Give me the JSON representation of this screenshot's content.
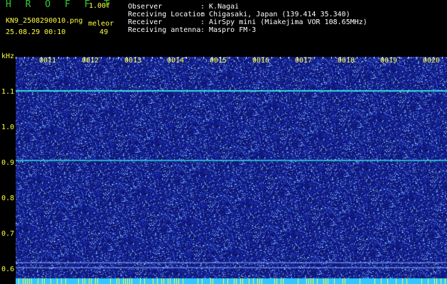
{
  "header": {
    "brand": "H R O F F T",
    "version": "1.00f",
    "file_name": "KN9_2508290010.png",
    "meteor_label": "meleor",
    "datetime": "25.08.29 00:10",
    "meteor_count": "49"
  },
  "meta": [
    {
      "label": "Observer",
      "value": "K.Nagai"
    },
    {
      "label": "Receiving Location",
      "value": "Chigasaki, Japan (139.414 35.340)"
    },
    {
      "label": "Receiver",
      "value": "AirSpy mini (Miakejima VOR 108.65MHz)"
    },
    {
      "label": "Receiving antenna",
      "value": "Maspro FM-3"
    }
  ],
  "axis": {
    "unit": "kHz",
    "y_ticks": [
      "1.1",
      "1.0",
      "0.9",
      "0.8",
      "0.7",
      "0.6"
    ],
    "x_ticks": [
      "0011",
      "0012",
      "0013",
      "0014",
      "0015",
      "0016",
      "0017",
      "0018",
      "0019",
      "0020"
    ]
  },
  "colors": {
    "background": "#000000",
    "spectrum_blue": "#1e2f8c",
    "carrier_line": "#33dddd",
    "bottom_band": "#30c8ff",
    "text": "#ffff40"
  }
}
